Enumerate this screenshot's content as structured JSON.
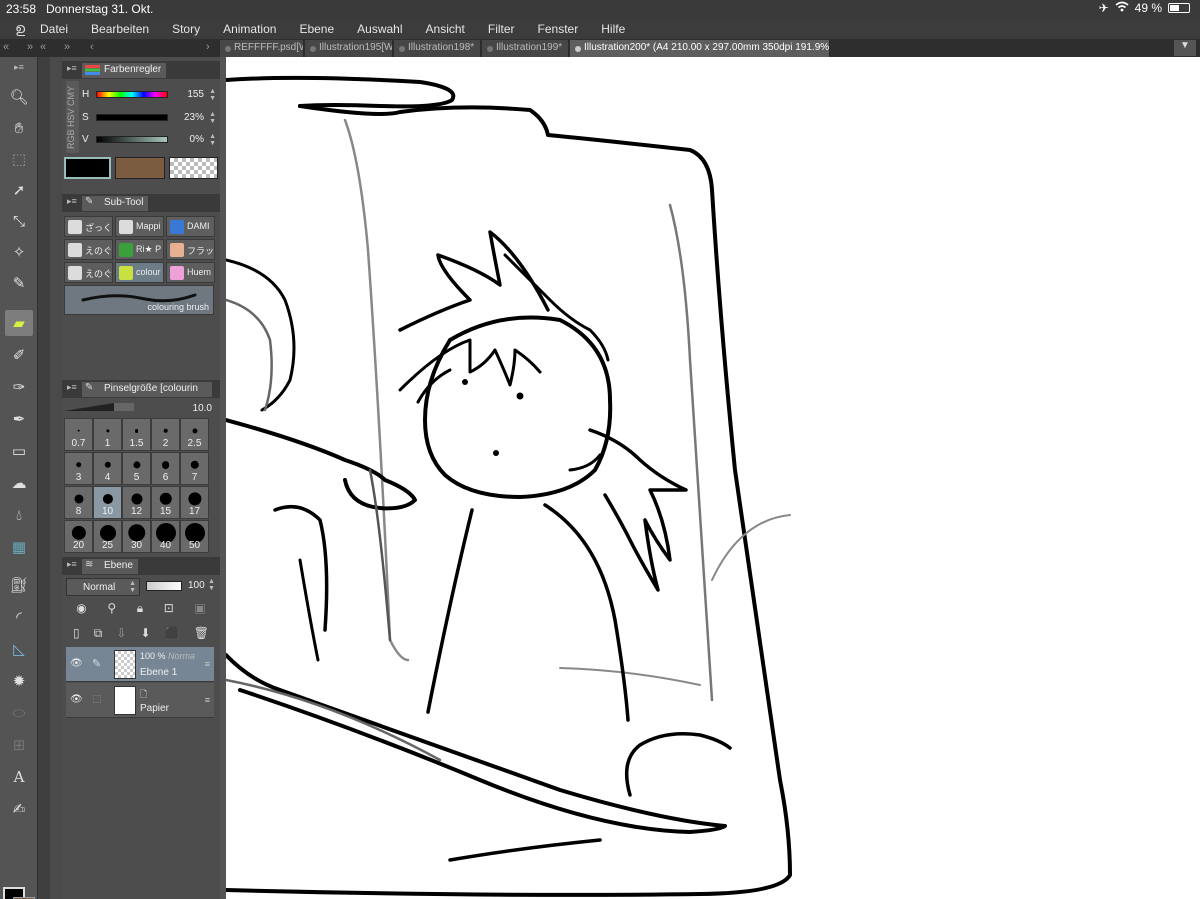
{
  "statusbar": {
    "time": "23:58",
    "date": "Donnerstag 31. Okt.",
    "battery": "49 %",
    "battery_level": 0.49
  },
  "menubar": {
    "items": [
      "Datei",
      "Bearbeiten",
      "Story",
      "Animation",
      "Ebene",
      "Auswahl",
      "Ansicht",
      "Filter",
      "Fenster",
      "Hilfe"
    ]
  },
  "tabs": [
    {
      "label": "REFFFFF.psd[W"
    },
    {
      "label": "Illustration195[W"
    },
    {
      "label": "Illustration198*"
    },
    {
      "label": "Illustration199*"
    },
    {
      "label": "Illustration200* (A4 210.00 x 297.00mm 350dpi 191.9%)"
    }
  ],
  "color_panel": {
    "title": "Farbenregler",
    "modes": "RGB HSV CMY",
    "h_label": "H",
    "h_value": "155",
    "s_label": "S",
    "s_value": "23%",
    "v_label": "V",
    "v_value": "0%",
    "main_color": "#000000",
    "sub_color": "#7b5c40"
  },
  "subtool_panel": {
    "title": "Sub-Tool",
    "items": [
      {
        "label": "ざっく",
        "color": "#dcdcdc"
      },
      {
        "label": "Mappi",
        "color": "#dcdcdc"
      },
      {
        "label": "DAMI",
        "color": "#3a78d8"
      },
      {
        "label": "えのぐ",
        "color": "#dcdcdc"
      },
      {
        "label": "Ri★ P",
        "color": "#3aa13a"
      },
      {
        "label": "フラッ",
        "color": "#e8b090"
      },
      {
        "label": "えのぐ",
        "color": "#dcdcdc"
      },
      {
        "label": "colour",
        "color": "#c8e040"
      },
      {
        "label": "Huem",
        "color": "#f0a0d8"
      }
    ],
    "preview_label": "colouring brush"
  },
  "brushsize_panel": {
    "title": "Pinselgröße [colourin",
    "value": "10.0",
    "sizes": [
      "0.7",
      "1",
      "1.5",
      "2",
      "2.5",
      "3",
      "4",
      "5",
      "6",
      "7",
      "8",
      "10",
      "12",
      "15",
      "17",
      "20",
      "25",
      "30",
      "40",
      "50"
    ],
    "selected": "10"
  },
  "layer_panel": {
    "title": "Ebene",
    "blend_mode": "Normal",
    "opacity": "100",
    "layers": [
      {
        "opacity_label": "100 %",
        "mode": "Norma",
        "name": "Ebene 1"
      },
      {
        "name": "Papier"
      }
    ]
  }
}
